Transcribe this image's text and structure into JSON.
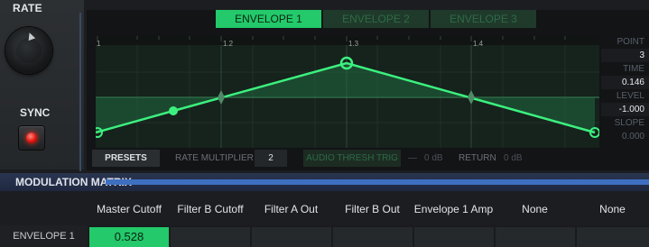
{
  "rate_panel": {
    "rate_label": "RATE",
    "sync_label": "SYNC"
  },
  "tabs": [
    {
      "label": "ENVELOPE 1",
      "active": true
    },
    {
      "label": "ENVELOPE 2",
      "active": false
    },
    {
      "label": "ENVELOPE 3",
      "active": false
    }
  ],
  "graph": {
    "ruler": [
      "1",
      "1.2",
      "1.3",
      "1.4"
    ]
  },
  "side_readout": {
    "point_label": "POINT",
    "point_value": "3",
    "time_label": "TIME",
    "time_value": "0.146",
    "level_label": "LEVEL",
    "level_value": "-1.000",
    "slope_label": "SLOPE",
    "slope_value": "0.000"
  },
  "bottom_bar": {
    "presets_label": "PRESETS",
    "rate_multiplier_label": "RATE MULTIPLIER",
    "rate_multiplier_value": "2",
    "audio_thresh_label": "AUDIO THRESH TRIG",
    "threshold_value": "0 dB",
    "return_label": "RETURN",
    "return_value": "0 dB"
  },
  "modulation_matrix": {
    "title": "MODULATION MATRIX",
    "columns": [
      "Master Cutoff",
      "Filter B Cutoff",
      "Filter A Out",
      "Filter B Out",
      "Envelope 1 Amp",
      "None",
      "None"
    ],
    "row_label": "ENVELOPE 1",
    "row_values": [
      "0.528",
      "",
      "",
      "",
      "",
      "",
      ""
    ]
  },
  "colors": {
    "accent_green": "#23c96a",
    "matrix_blue": "#3e6fc0",
    "sync_led_red": "#e0140c"
  }
}
